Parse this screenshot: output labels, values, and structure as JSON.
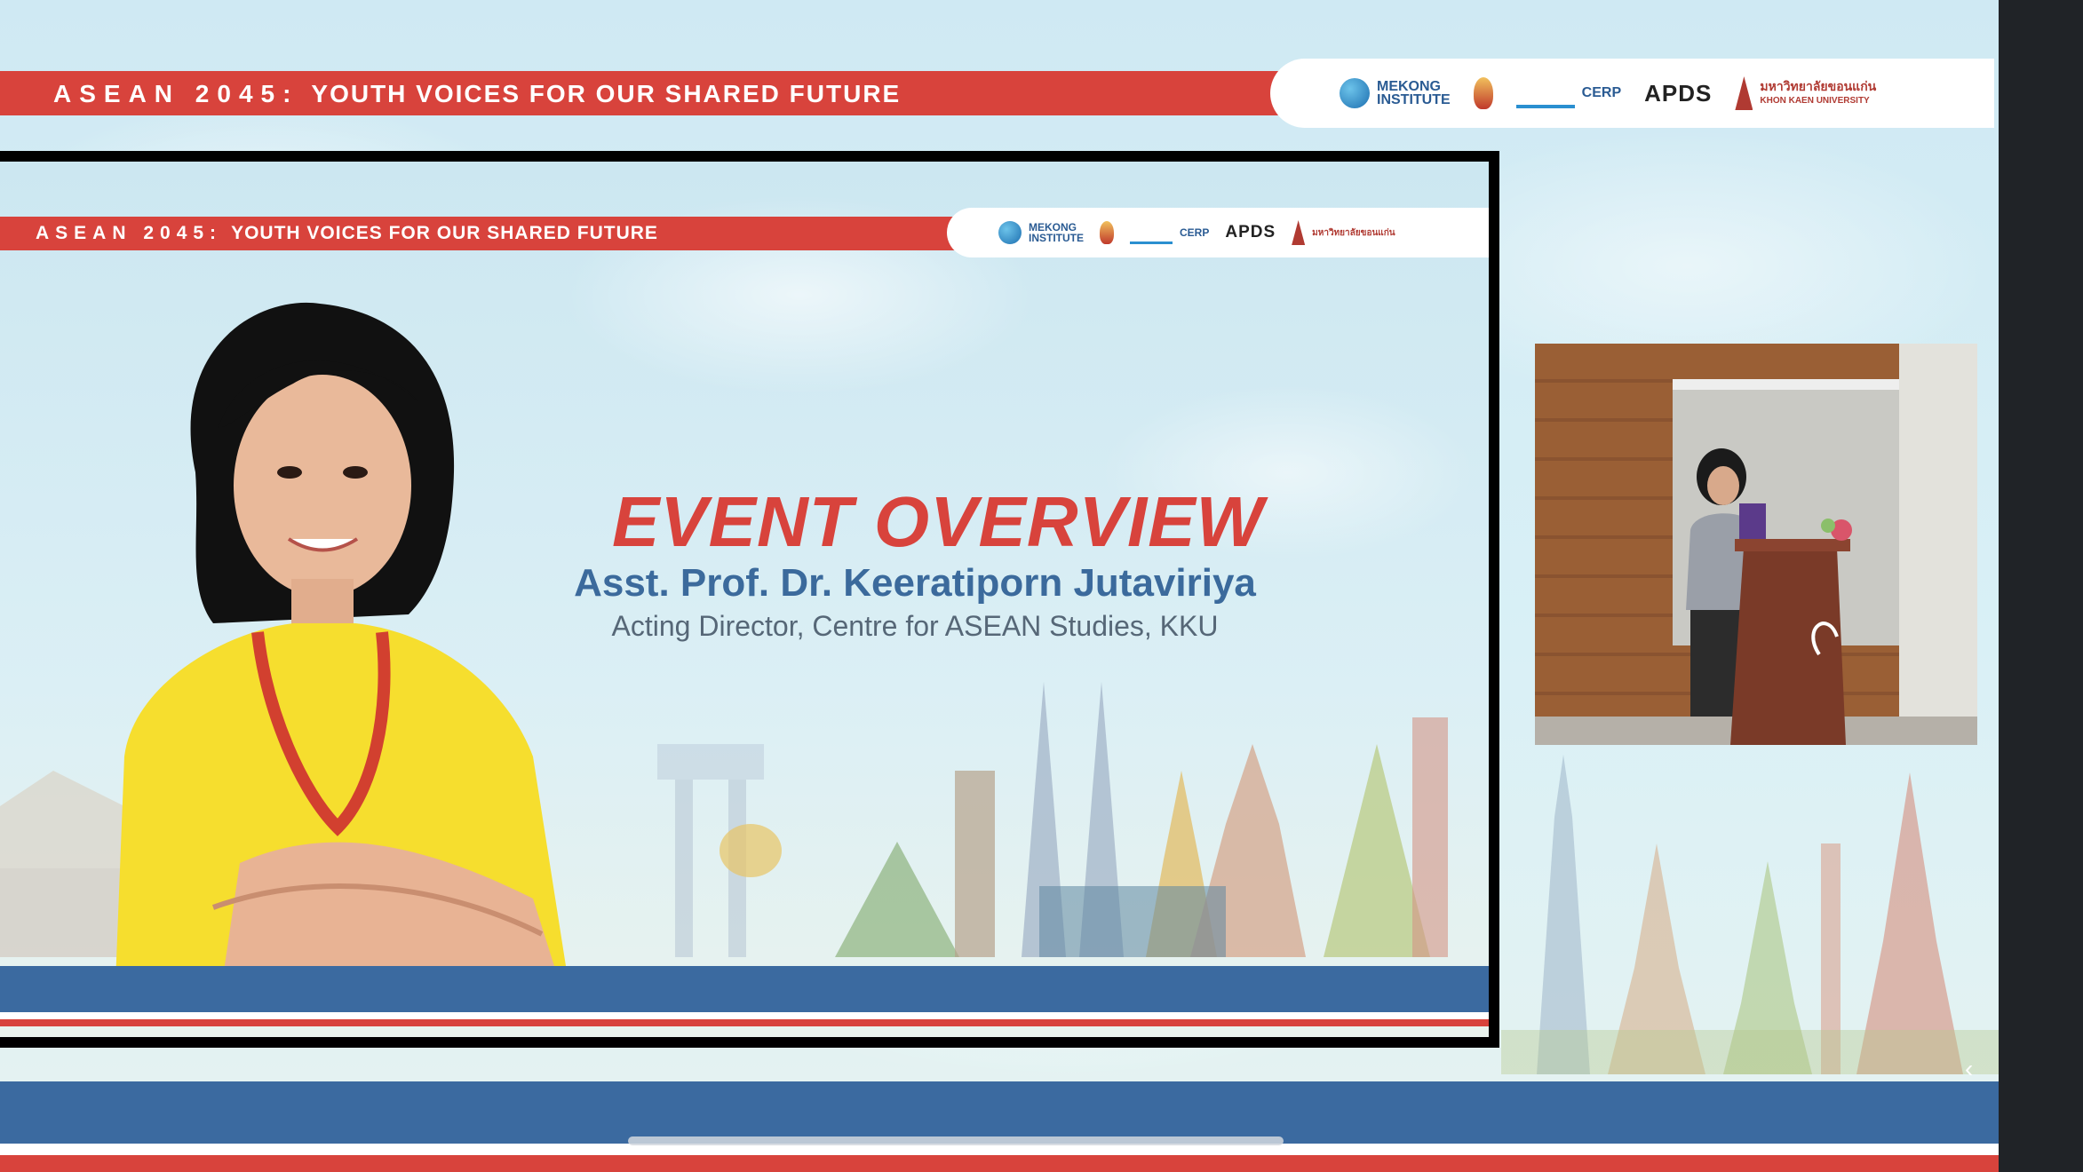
{
  "banner": {
    "lead": "ASEAN 2045:",
    "tagline": "YOUTH VOICES FOR OUR SHARED FUTURE"
  },
  "logos": {
    "mekong_line1": "MEKONG",
    "mekong_line2": "INSTITUTE",
    "cerp": "CERP",
    "apds": "APDS",
    "kku": "มหาวิทยาลัยขอนแก่น",
    "kku_en": "KHON KAEN UNIVERSITY"
  },
  "slide": {
    "banner_lead": "ASEAN 2045:",
    "banner_tagline": "YOUTH VOICES FOR OUR SHARED FUTURE",
    "title": "EVENT OVERVIEW",
    "speaker_name": "Asst. Prof. Dr. Keeratiporn Jutaviriya",
    "speaker_role": "Acting Director, Centre for ASEAN Studies, KKU"
  },
  "icons": {
    "scroll": "chevron-left-icon"
  },
  "colors": {
    "accent_red": "#d8433c",
    "accent_blue": "#3b6aa0",
    "name_blue": "#3b6a9c"
  }
}
